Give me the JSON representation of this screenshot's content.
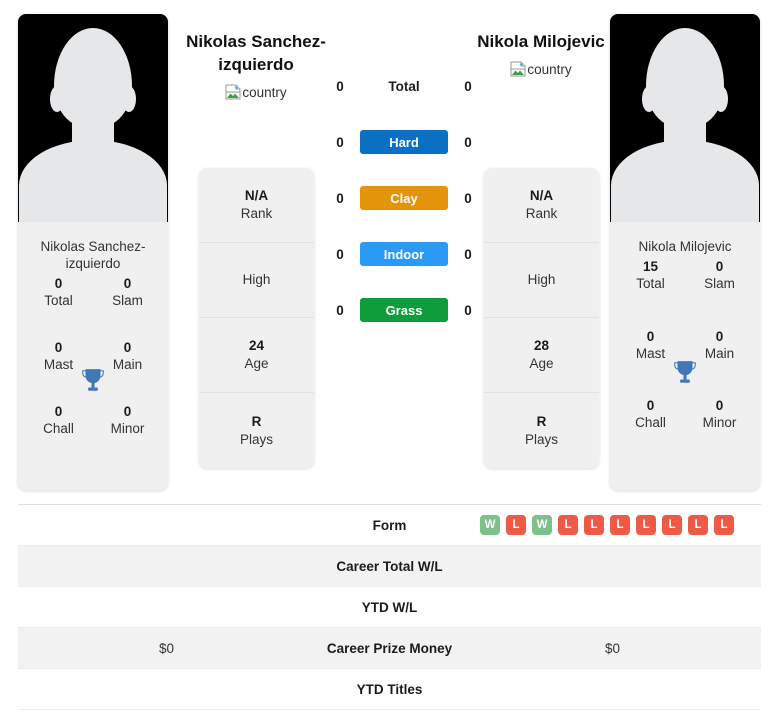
{
  "players": {
    "left": {
      "name_header": "Nikolas Sanchez-izquierdo",
      "card_name": "Nikolas Sanchez-izquierdo",
      "country_alt": "country",
      "titles": [
        {
          "num": "0",
          "label": "Total"
        },
        {
          "num": "0",
          "label": "Slam"
        },
        {
          "num": "0",
          "label": "Mast"
        },
        {
          "num": "0",
          "label": "Main"
        },
        {
          "num": "0",
          "label": "Chall"
        },
        {
          "num": "0",
          "label": "Minor"
        }
      ],
      "info": [
        {
          "value": "N/A",
          "label": "Rank"
        },
        {
          "value": "",
          "label": "High"
        },
        {
          "value": "24",
          "label": "Age"
        },
        {
          "value": "R",
          "label": "Plays"
        }
      ],
      "prize_money": "$0"
    },
    "right": {
      "name_header": "Nikola Milojevic",
      "card_name": "Nikola Milojevic",
      "country_alt": "country",
      "titles": [
        {
          "num": "15",
          "label": "Total"
        },
        {
          "num": "0",
          "label": "Slam"
        },
        {
          "num": "0",
          "label": "Mast"
        },
        {
          "num": "0",
          "label": "Main"
        },
        {
          "num": "0",
          "label": "Chall"
        },
        {
          "num": "0",
          "label": "Minor"
        }
      ],
      "info": [
        {
          "value": "N/A",
          "label": "Rank"
        },
        {
          "value": "",
          "label": "High"
        },
        {
          "value": "28",
          "label": "Age"
        },
        {
          "value": "R",
          "label": "Plays"
        }
      ],
      "prize_money": "$0"
    }
  },
  "surfaces": [
    {
      "label": "Total",
      "left": "0",
      "right": "0",
      "color": "none"
    },
    {
      "label": "Hard",
      "left": "0",
      "right": "0",
      "color": "#0b6fc4"
    },
    {
      "label": "Clay",
      "left": "0",
      "right": "0",
      "color": "#e3940a"
    },
    {
      "label": "Indoor",
      "left": "0",
      "right": "0",
      "color": "#2a9af4"
    },
    {
      "label": "Grass",
      "left": "0",
      "right": "0",
      "color": "#0f9d3c"
    }
  ],
  "table": {
    "form_label": "Form",
    "form_results": [
      "W",
      "L",
      "W",
      "L",
      "L",
      "L",
      "L",
      "L",
      "L",
      "L"
    ],
    "career_total_wl": "Career Total W/L",
    "ytd_wl": "YTD W/L",
    "career_prize_money": "Career Prize Money",
    "ytd_titles": "YTD Titles"
  },
  "colors": {
    "win": "#7cc08a",
    "loss": "#ef5a47",
    "trophy": "#4178b8",
    "card_bg": "#f0f0f0"
  }
}
